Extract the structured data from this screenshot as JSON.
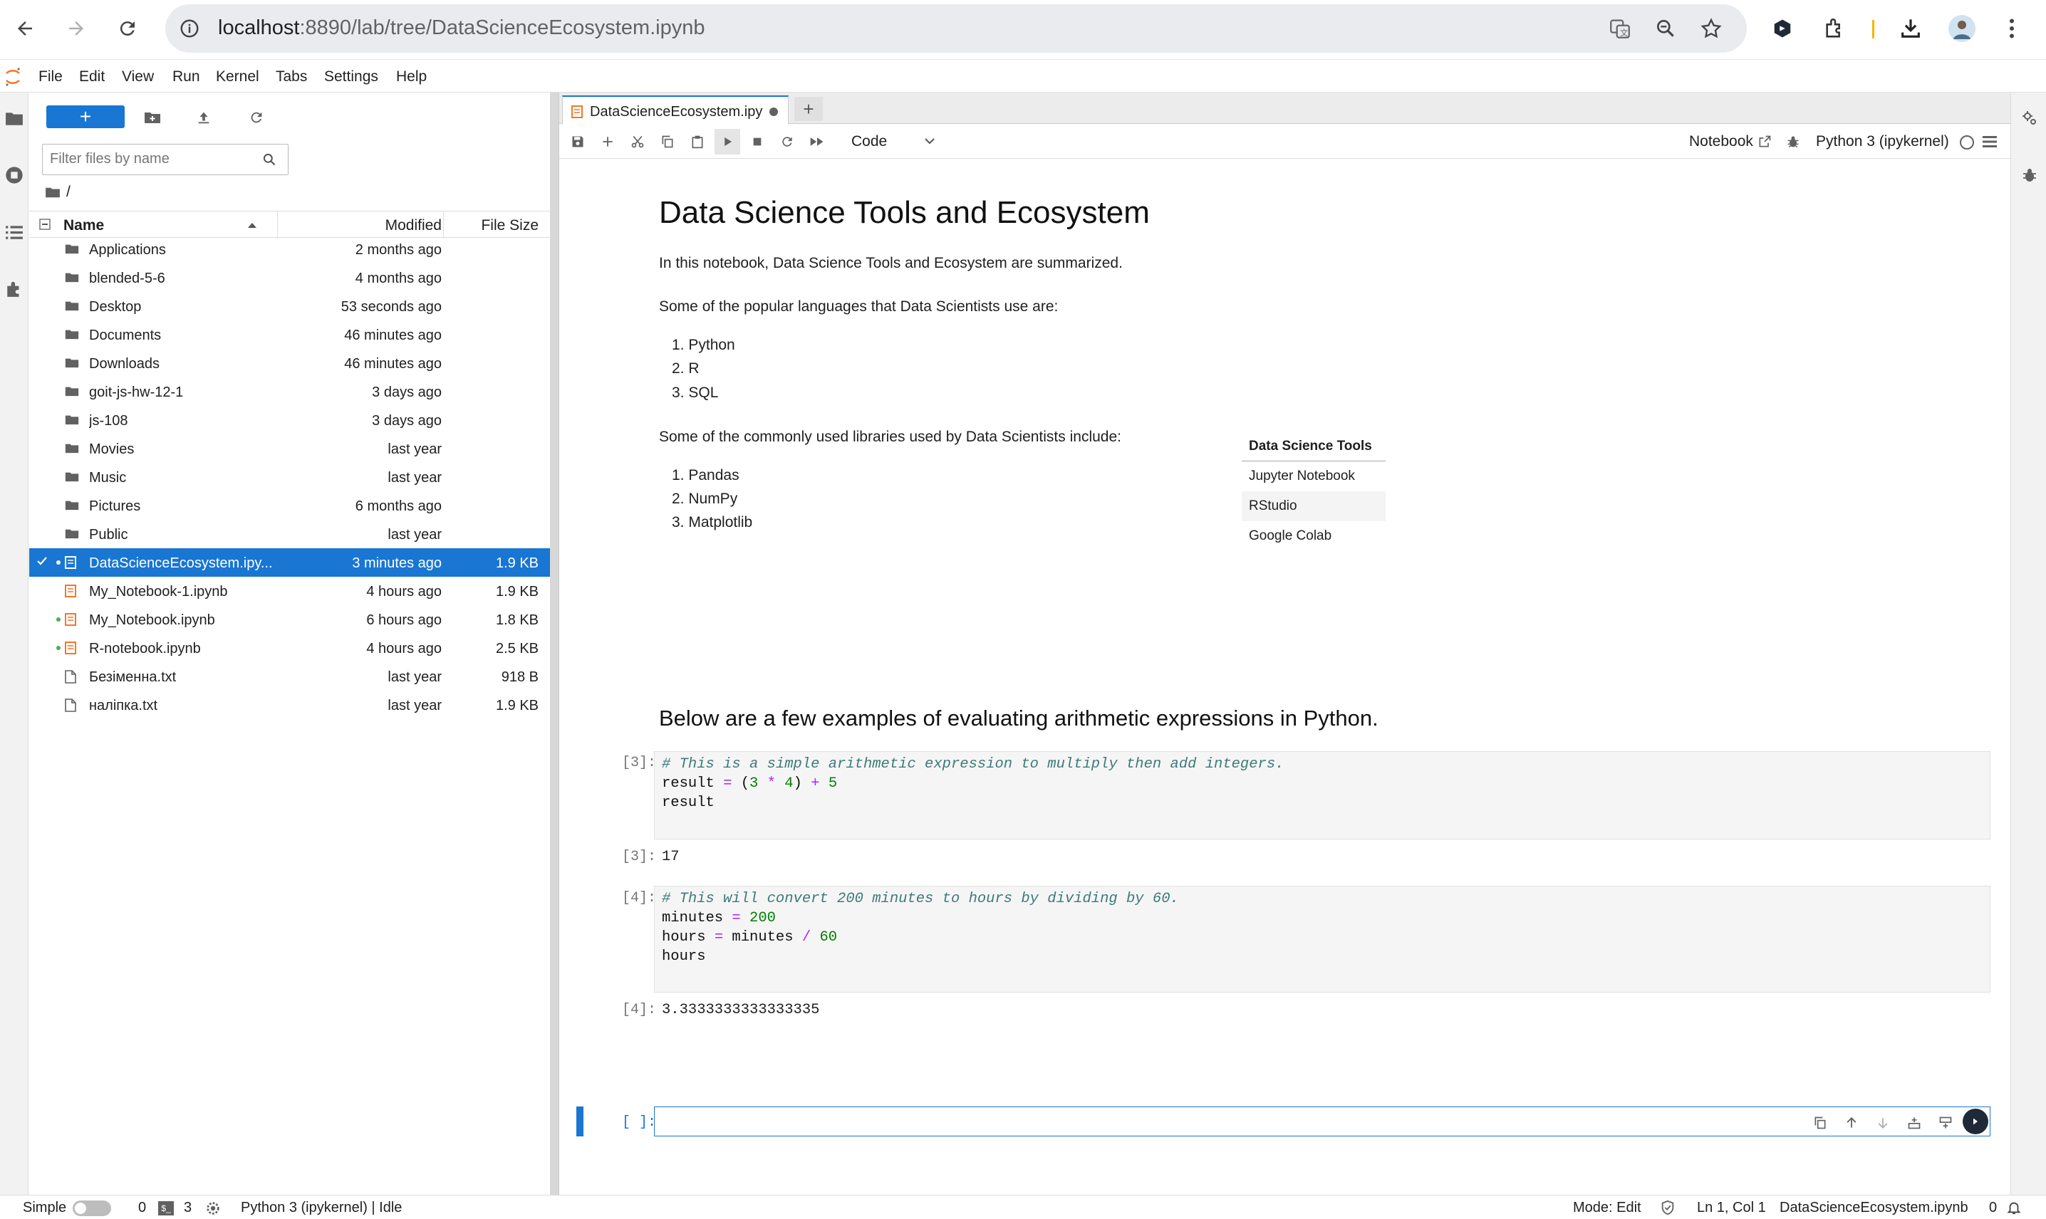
{
  "browser": {
    "url_host": "localhost",
    "url_path": ":8890/lab/tree/DataScienceEcosystem.ipynb"
  },
  "menu": [
    "File",
    "Edit",
    "View",
    "Run",
    "Kernel",
    "Tabs",
    "Settings",
    "Help"
  ],
  "filebrowser": {
    "new_label": "+",
    "filter_placeholder": "Filter files by name",
    "breadcrumb": "/",
    "col_name": "Name",
    "col_modified": "Modified",
    "col_size": "File Size",
    "files": [
      {
        "name": "Applications",
        "modified": "2 months ago",
        "size": "",
        "type": "folder"
      },
      {
        "name": "blended-5-6",
        "modified": "4 months ago",
        "size": "",
        "type": "folder"
      },
      {
        "name": "Desktop",
        "modified": "53 seconds ago",
        "size": "",
        "type": "folder"
      },
      {
        "name": "Documents",
        "modified": "46 minutes ago",
        "size": "",
        "type": "folder"
      },
      {
        "name": "Downloads",
        "modified": "46 minutes ago",
        "size": "",
        "type": "folder"
      },
      {
        "name": "goit-js-hw-12-1",
        "modified": "3 days ago",
        "size": "",
        "type": "folder"
      },
      {
        "name": "js-108",
        "modified": "3 days ago",
        "size": "",
        "type": "folder"
      },
      {
        "name": "Movies",
        "modified": "last year",
        "size": "",
        "type": "folder"
      },
      {
        "name": "Music",
        "modified": "last year",
        "size": "",
        "type": "folder"
      },
      {
        "name": "Pictures",
        "modified": "6 months ago",
        "size": "",
        "type": "folder"
      },
      {
        "name": "Public",
        "modified": "last year",
        "size": "",
        "type": "folder"
      },
      {
        "name": "DataScienceEcosystem.ipy...",
        "modified": "3 minutes ago",
        "size": "1.9 KB",
        "type": "notebook",
        "selected": true,
        "running": true
      },
      {
        "name": "My_Notebook-1.ipynb",
        "modified": "4 hours ago",
        "size": "1.9 KB",
        "type": "notebook"
      },
      {
        "name": "My_Notebook.ipynb",
        "modified": "6 hours ago",
        "size": "1.8 KB",
        "type": "notebook",
        "running": true
      },
      {
        "name": "R-notebook.ipynb",
        "modified": "4 hours ago",
        "size": "2.5 KB",
        "type": "notebook",
        "running": true
      },
      {
        "name": "Безіменна.txt",
        "modified": "last year",
        "size": "918 B",
        "type": "file"
      },
      {
        "name": "наліпка.txt",
        "modified": "last year",
        "size": "1.9 KB",
        "type": "file"
      }
    ]
  },
  "notebook": {
    "tab_title": "DataScienceEcosystem.ipy",
    "cell_type": "Code",
    "notebook_label": "Notebook",
    "kernel_name": "Python 3 (ipykernel)",
    "title": "Data Science Tools and Ecosystem",
    "intro": "In this notebook, Data Science Tools and Ecosystem are summarized.",
    "languages_intro": "Some of the popular languages that Data Scientists use are:",
    "languages": [
      "1. Python",
      "2. R",
      "3. SQL"
    ],
    "libraries_intro": "Some of the commonly used libraries used by Data Scientists include:",
    "libraries": [
      "1. Pandas",
      "2. NumPy",
      "3. Matplotlib"
    ],
    "tools_header": "Data Science Tools",
    "tools": [
      "Jupyter Notebook",
      "RStudio",
      "Google Colab"
    ],
    "examples_heading": "Below are a few examples of evaluating arithmetic expressions in Python.",
    "cell1_prompt": "[3]:",
    "cell1_comment": "# This is a simple arithmetic expression to multiply then add integers.",
    "cell1_output_prompt": "[3]:",
    "cell1_output": "17",
    "cell2_prompt": "[4]:",
    "cell2_comment": "# This will convert 200 minutes to hours by dividing by 60.",
    "cell2_output_prompt": "[4]:",
    "cell2_output": "3.3333333333333335",
    "cell3_prompt": "[ ]:"
  },
  "status": {
    "mode_label": "Simple",
    "terminals": "0",
    "kernels": "3",
    "kernel_status": "Python 3 (ipykernel) | Idle",
    "edit_mode": "Mode: Edit",
    "cursor": "Ln 1, Col 1",
    "filename": "DataScienceEcosystem.ipynb",
    "notifications": "0"
  },
  "colors": {
    "accent": "#1976d2",
    "notebook_icon": "#f37726"
  }
}
